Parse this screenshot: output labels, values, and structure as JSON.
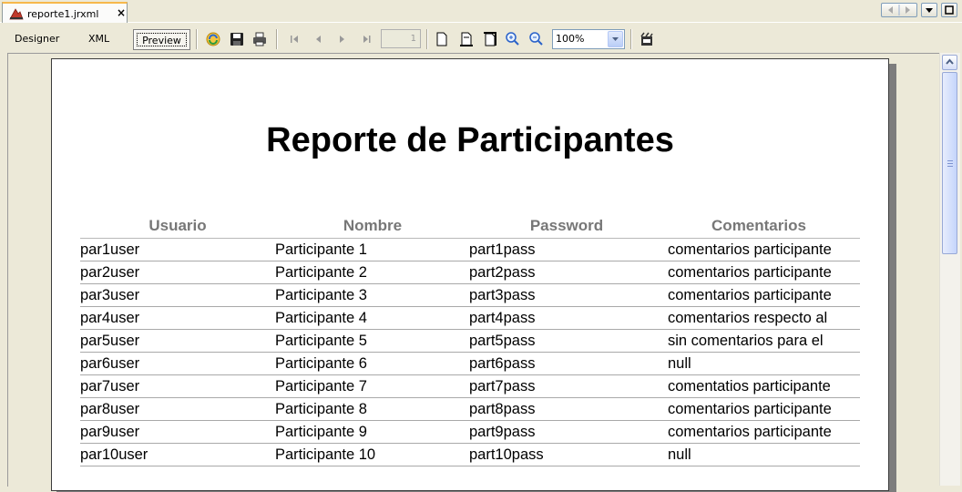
{
  "tabs": [
    {
      "label": "reporte1.jrxml",
      "close": "×",
      "icon": "report-file-icon"
    }
  ],
  "toolbar": {
    "designer_label": "Designer",
    "xml_label": "XML",
    "preview_label": "Preview",
    "page_number": "1",
    "zoom_value": "100%",
    "icons": [
      "refresh-icon",
      "save-icon",
      "print-icon",
      "first-page-icon",
      "previous-page-icon",
      "next-page-icon",
      "last-page-icon",
      "page-icon",
      "page-width-icon",
      "page-fit-icon",
      "zoom-in-icon",
      "zoom-out-icon",
      "zoom-dropdown-icon",
      "export-icon"
    ]
  },
  "report": {
    "title": "Reporte de Participantes",
    "columns": [
      "Usuario",
      "Nombre",
      "Password",
      "Comentarios"
    ],
    "rows": [
      [
        "par1user",
        "Participante 1",
        "part1pass",
        "comentarios participante"
      ],
      [
        "par2user",
        "Participante 2",
        "part2pass",
        "comentarios participante"
      ],
      [
        "par3user",
        "Participante 3",
        "part3pass",
        "comentarios participante"
      ],
      [
        "par4user",
        "Participante 4",
        "part4pass",
        "comentarios respecto al"
      ],
      [
        "par5user",
        "Participante 5",
        "part5pass",
        "sin comentarios para el"
      ],
      [
        "par6user",
        "Participante 6",
        "part6pass",
        "null"
      ],
      [
        "par7user",
        "Participante 7",
        "part7pass",
        "comentatios participante"
      ],
      [
        "par8user",
        "Participante 8",
        "part8pass",
        "comentarios participante"
      ],
      [
        "par9user",
        "Participante 9",
        "part9pass",
        "comentarios participante"
      ],
      [
        "par10user",
        "Participante 10",
        "part10pass",
        "null"
      ]
    ]
  },
  "colors": {
    "tab_accent": "#f7b84b",
    "header_text": "#777777",
    "window_bg": "#ece9d8"
  }
}
